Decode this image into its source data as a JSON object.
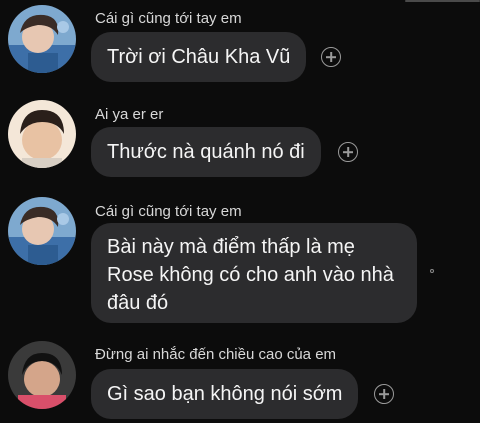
{
  "messages": [
    {
      "sender": "Cái gì cũng tới tay em",
      "lines": [
        "Trời ơi Châu Kha Vũ"
      ],
      "avatar_icon": "user-avatar-photo"
    },
    {
      "sender": "Ai ya er er",
      "lines": [
        "Thước nà quánh nó đi"
      ],
      "avatar_icon": "user-avatar-photo"
    },
    {
      "sender": "Cái gì cũng tới tay em",
      "lines": [
        "Bài này mà điểm thấp là mẹ",
        "Rose không có cho anh vào nhà",
        "đâu đó"
      ],
      "avatar_icon": "user-avatar-photo"
    },
    {
      "sender": "Đừng ai nhắc đến chiều cao của em",
      "lines": [
        "Gì sao bạn không nói sớm"
      ],
      "avatar_icon": "user-avatar-photo"
    }
  ],
  "icons": {
    "reaction": "add-reaction-icon",
    "seen": "seen-indicator-icon"
  },
  "colors": {
    "background": "#0c0c0c",
    "bubble": "#2c2c2e",
    "text": "#f5f5f5",
    "sender_text": "#d8d8d8",
    "icon": "#9a9a9a"
  }
}
